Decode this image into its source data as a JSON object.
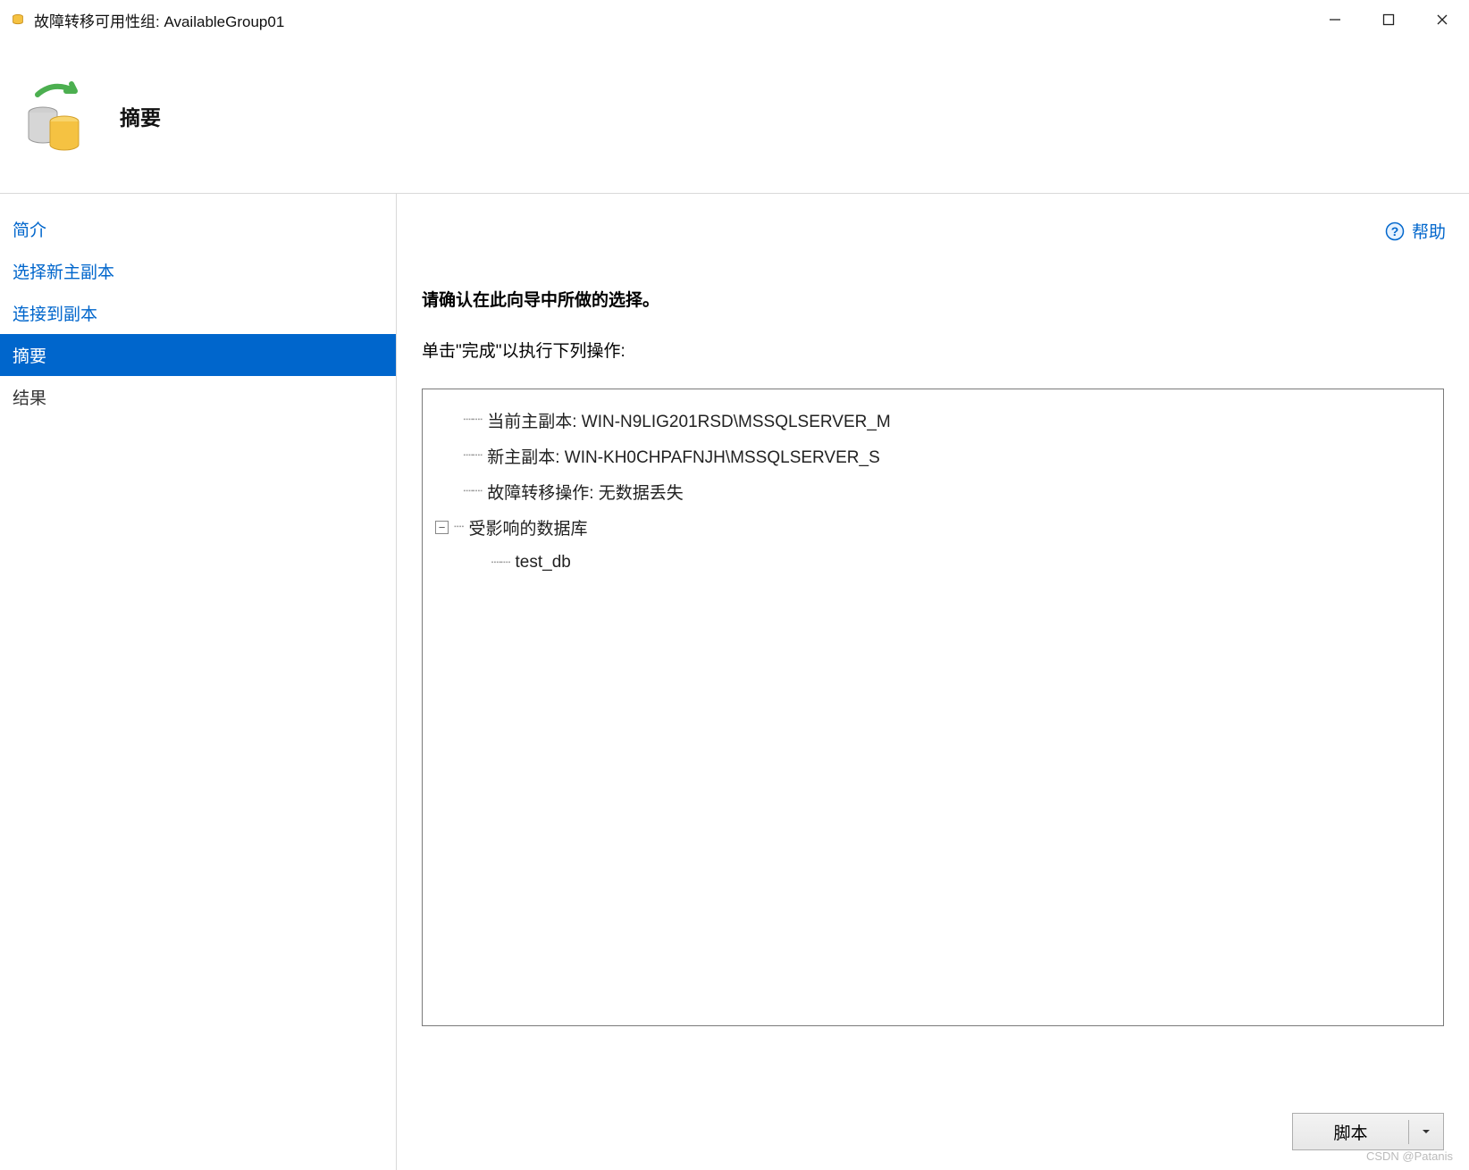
{
  "titlebar": {
    "title": "故障转移可用性组: AvailableGroup01"
  },
  "header": {
    "title": "摘要"
  },
  "sidebar": {
    "items": [
      {
        "label": "简介",
        "state": "link"
      },
      {
        "label": "选择新主副本",
        "state": "link"
      },
      {
        "label": "连接到副本",
        "state": "link"
      },
      {
        "label": "摘要",
        "state": "active"
      },
      {
        "label": "结果",
        "state": "plain"
      }
    ]
  },
  "content": {
    "help_label": "帮助",
    "instruction1": "请确认在此向导中所做的选择。",
    "instruction2": "单击\"完成\"以执行下列操作:",
    "tree": {
      "current_primary": "当前主副本: WIN-N9LIG201RSD\\MSSQLSERVER_M",
      "new_primary": "新主副本: WIN-KH0CHPAFNJH\\MSSQLSERVER_S",
      "failover_op": "故障转移操作: 无数据丢失",
      "affected_db_label": "受影响的数据库",
      "affected_dbs": [
        "test_db"
      ]
    },
    "script_button": "脚本"
  },
  "watermark": "CSDN @Patanis"
}
